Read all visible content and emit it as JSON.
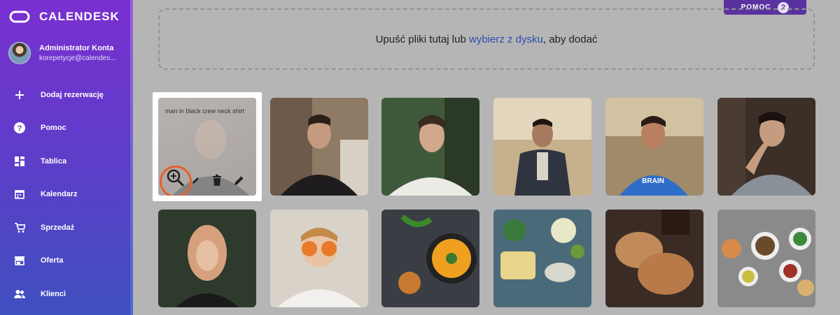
{
  "brand": {
    "name": "CALENDESK"
  },
  "account": {
    "name": "Administrator Konta",
    "email": "korepetycje@calendes..."
  },
  "nav": [
    {
      "label": "Dodaj rezerwację",
      "icon": "plus-icon"
    },
    {
      "label": "Pomoc",
      "icon": "help-circle-icon"
    },
    {
      "label": "Tablica",
      "icon": "dashboard-icon"
    },
    {
      "label": "Kalendarz",
      "icon": "calendar-icon"
    },
    {
      "label": "Sprzedaż",
      "icon": "cart-icon"
    },
    {
      "label": "Oferta",
      "icon": "store-icon"
    },
    {
      "label": "Klienci",
      "icon": "people-icon"
    }
  ],
  "help_button": {
    "label": "POMOC",
    "icon": "?"
  },
  "dropzone": {
    "text_before": "Upuść pliki tutaj lub ",
    "link_text": "wybierz z dysku",
    "text_after": ", aby dodać"
  },
  "gallery": {
    "selected_caption": "man in black crew neck shirt",
    "selected_actions": [
      "zoom-in-icon",
      "edit-pencil-icon",
      "delete-icon",
      "edit-icon"
    ],
    "images": [
      {
        "name": "image-man-black-shirt",
        "row": 1,
        "col": 1
      },
      {
        "name": "image-man-white-shirt-garden",
        "row": 1,
        "col": 2
      },
      {
        "name": "image-man-jacket-field",
        "row": 1,
        "col": 3
      },
      {
        "name": "image-man-blue-tshirt",
        "row": 1,
        "col": 4
      },
      {
        "name": "image-man-grey-shirt-pose",
        "row": 1,
        "col": 5
      },
      {
        "name": "image-woman-portrait",
        "row": 2,
        "col": 1
      },
      {
        "name": "image-child-orange-slices",
        "row": 2,
        "col": 2
      },
      {
        "name": "image-soup-bowl",
        "row": 2,
        "col": 3
      },
      {
        "name": "image-bread-dips",
        "row": 2,
        "col": 4
      },
      {
        "name": "image-bread-rolls",
        "row": 2,
        "col": 5
      },
      {
        "name": "image-food-dishes",
        "row": 2,
        "col": 6
      }
    ]
  },
  "colors": {
    "accent": "#e8602c",
    "link": "#2a4fb0",
    "sidebar_top": "#7a2fd0",
    "sidebar_bottom": "#3f4fbe"
  }
}
